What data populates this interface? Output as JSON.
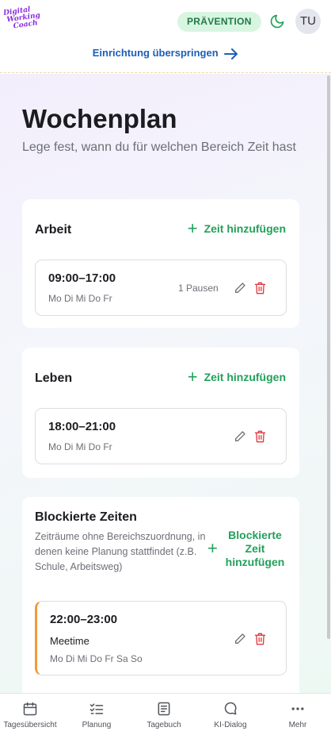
{
  "header": {
    "logo_lines": [
      "Digital",
      "Working",
      "Coach"
    ],
    "badge": "PRÄVENTION",
    "avatar_initials": "TU",
    "skip_link": "Einrichtung überspringen"
  },
  "page": {
    "title": "Wochenplan",
    "subtitle": "Lege fest, wann du für welchen Bereich Zeit hast"
  },
  "sections": {
    "work": {
      "title": "Arbeit",
      "add_label": "Zeit hinzufügen",
      "slots": [
        {
          "time": "09:00–17:00",
          "days": "Mo Di Mi Do Fr",
          "pauses": "1 Pausen"
        }
      ]
    },
    "life": {
      "title": "Leben",
      "add_label": "Zeit hinzufügen",
      "slots": [
        {
          "time": "18:00–21:00",
          "days": "Mo Di Mi Do Fr"
        }
      ]
    },
    "blocked": {
      "title": "Blockierte Zeiten",
      "description": "Zeiträume ohne Bereichszuordnung, in denen keine Planung stattfindet (z.B. Schule, Arbeitsweg)",
      "add_label": "Blockierte Zeit hinzufügen",
      "slots": [
        {
          "time": "22:00–23:00",
          "name": "Meetime",
          "days": "Mo Di Mi Do Fr Sa So"
        }
      ]
    }
  },
  "nav": [
    {
      "label": "Tagesübersicht",
      "icon": "calendar-icon"
    },
    {
      "label": "Planung",
      "icon": "checklist-icon"
    },
    {
      "label": "Tagebuch",
      "icon": "book-icon"
    },
    {
      "label": "KI-Dialog",
      "icon": "chat-icon"
    },
    {
      "label": "Mehr",
      "icon": "more-dots-icon"
    }
  ],
  "colors": {
    "accent_green": "#22a05a",
    "delete_red": "#e0393e",
    "link_blue": "#1d5fb5",
    "blocked_marker": "#f29a38",
    "badge_bg": "#d8f5e2"
  }
}
